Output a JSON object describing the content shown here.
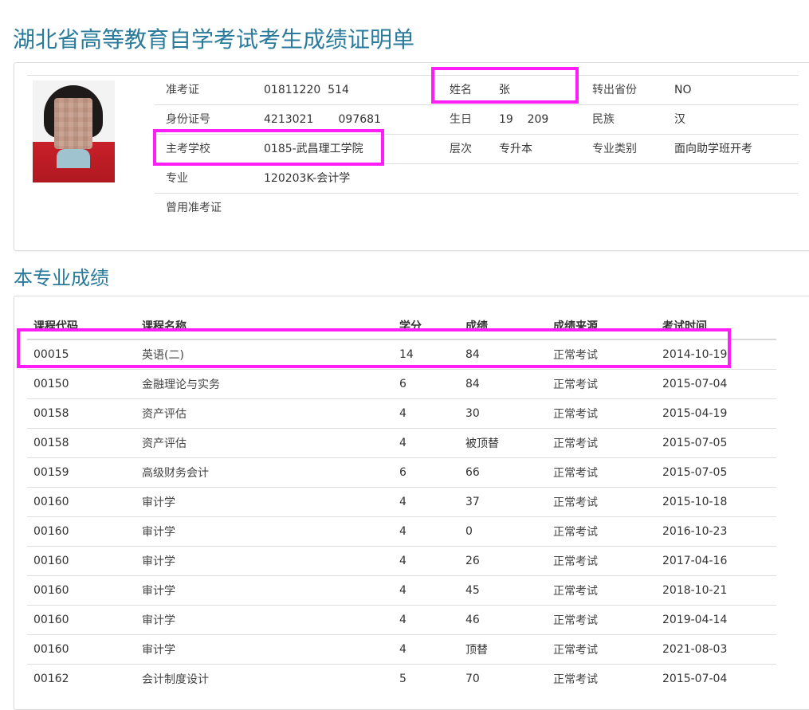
{
  "page_title": "湖北省高等教育自学考试考生成绩证明单",
  "photo_icon": "student-photo",
  "info": {
    "exam_id_label": "准考证",
    "exam_id_value": "01811220  514",
    "name_label": "姓名",
    "name_value": "张",
    "transfer_label": "转出省份",
    "transfer_value": "NO",
    "id_card_label": "身份证号",
    "id_card_value": "4213021       097681",
    "birth_label": "生日",
    "birth_value": "19    209",
    "ethnicity_label": "民族",
    "ethnicity_value": "汉",
    "school_label": "主考学校",
    "school_value": "0185-武昌理工学院",
    "level_label": "层次",
    "level_value": "专升本",
    "category_label": "专业类别",
    "category_value": "面向助学班开考",
    "major_label": "专业",
    "major_value": "120203K-会计学",
    "former_id_label": "曾用准考证",
    "former_id_value": ""
  },
  "scores_title": "本专业成绩",
  "scores": {
    "headers": [
      "课程代码",
      "课程名称",
      "学分",
      "成绩",
      "成绩来源",
      "考试时间"
    ],
    "rows": [
      [
        "00015",
        "英语(二)",
        "14",
        "84",
        "正常考试",
        "2014-10-19"
      ],
      [
        "00150",
        "金融理论与实务",
        "6",
        "84",
        "正常考试",
        "2015-07-04"
      ],
      [
        "00158",
        "资产评估",
        "4",
        "30",
        "正常考试",
        "2015-04-19"
      ],
      [
        "00158",
        "资产评估",
        "4",
        "被顶替",
        "正常考试",
        "2015-07-05"
      ],
      [
        "00159",
        "高级财务会计",
        "6",
        "66",
        "正常考试",
        "2015-07-05"
      ],
      [
        "00160",
        "审计学",
        "4",
        "37",
        "正常考试",
        "2015-10-18"
      ],
      [
        "00160",
        "审计学",
        "4",
        "0",
        "正常考试",
        "2016-10-23"
      ],
      [
        "00160",
        "审计学",
        "4",
        "26",
        "正常考试",
        "2017-04-16"
      ],
      [
        "00160",
        "审计学",
        "4",
        "45",
        "正常考试",
        "2018-10-21"
      ],
      [
        "00160",
        "审计学",
        "4",
        "46",
        "正常考试",
        "2019-04-14"
      ],
      [
        "00160",
        "审计学",
        "4",
        "顶替",
        "正常考试",
        "2021-08-03"
      ],
      [
        "00162",
        "会计制度设计",
        "5",
        "70",
        "正常考试",
        "2015-07-04"
      ]
    ]
  },
  "colors": {
    "title": "#2a7b9b",
    "highlight": "#ff1ef7",
    "border": "#dedede"
  }
}
